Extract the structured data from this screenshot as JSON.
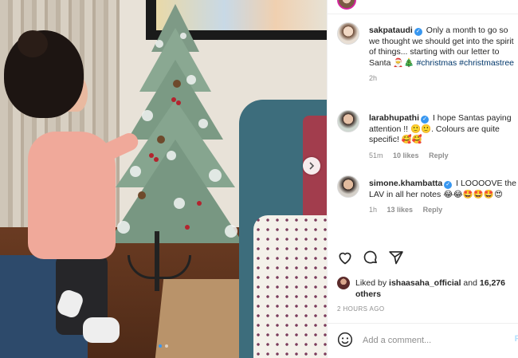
{
  "caption": {
    "username": "sakpataudi",
    "text": "Only a month to go so we thought we should get into the spirit of things... starting with our letter to Santa",
    "emojis": "🎅🎄",
    "hashtags": [
      "#christmas",
      "#christmastree"
    ],
    "time": "2h"
  },
  "comments": [
    {
      "username": "larabhupathi",
      "text": "I hope Santas paying attention !! 🙂🙂. Colours are quite specific! 🥰🥰",
      "time": "51m",
      "likes": "10 likes",
      "reply": "Reply"
    },
    {
      "username": "simone.khambatta",
      "text": "I LOOOOVE the LAV in all her notes 😂😂🤩🤩🤩😍",
      "time": "1h",
      "likes": "13 likes",
      "reply": "Reply"
    }
  ],
  "liked_by": {
    "prefix": "Liked by",
    "user": "ishaasaha_official",
    "and": "and",
    "others": "16,276 others"
  },
  "time_ago": "2 HOURS AGO",
  "add_comment": {
    "placeholder": "Add a comment...",
    "post_label": "P"
  },
  "icons": {
    "like": "heart-icon",
    "comment": "comment-icon",
    "share": "paper-plane-icon",
    "emoji": "smiley-icon",
    "next": "chevron-right-icon"
  },
  "colors": {
    "link": "#00376b",
    "verified": "#3897f0",
    "muted": "#8e8e8e",
    "post_disabled": "#b2dffc"
  },
  "carousel": {
    "count": 2,
    "active": 1
  }
}
